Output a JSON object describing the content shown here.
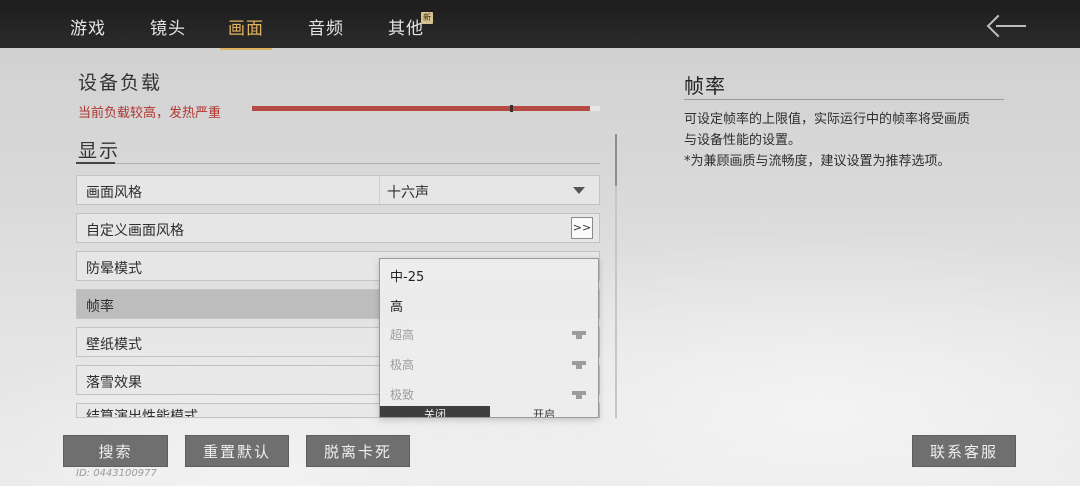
{
  "tabs": [
    {
      "label": "游戏",
      "active": false
    },
    {
      "label": "镜头",
      "active": false
    },
    {
      "label": "画面",
      "active": true
    },
    {
      "label": "音频",
      "active": false
    },
    {
      "label": "其他",
      "active": false
    }
  ],
  "new_badge": "新",
  "device_load": {
    "title": "设备负载",
    "warning": "当前负载较高，发热严重",
    "level": 0.97
  },
  "display": {
    "title": "显示",
    "rows": [
      {
        "label": "画面风格",
        "value": "十六声"
      },
      {
        "label": "自定义画面风格",
        "action": ">>"
      },
      {
        "label": "防晕模式"
      },
      {
        "label": "帧率"
      },
      {
        "label": "壁纸模式"
      },
      {
        "label": "落雪效果"
      },
      {
        "label": "结算演出性能模式"
      }
    ]
  },
  "dropdown": {
    "options": [
      {
        "label": "中-25",
        "locked": false
      },
      {
        "label": "高",
        "locked": false
      },
      {
        "label": "超高",
        "locked": true
      },
      {
        "label": "极高",
        "locked": true
      },
      {
        "label": "极致",
        "locked": true
      }
    ],
    "toggle_off": "关闭",
    "toggle_on": "开启"
  },
  "description": {
    "title": "帧率",
    "lines": [
      "可设定帧率的上限值，实际运行中的帧率将受画质",
      "与设备性能的设置。",
      "*为兼顾画质与流畅度，建议设置为推荐选项。"
    ]
  },
  "buttons": {
    "search": "搜索",
    "reset": "重置默认",
    "unstuck": "脱离卡死",
    "support": "联系客服"
  },
  "player_id": "ID: 0443100977",
  "colors": {
    "accent": "#e0b35c",
    "warning": "#b0342f",
    "load_fill": "#b54a45"
  }
}
